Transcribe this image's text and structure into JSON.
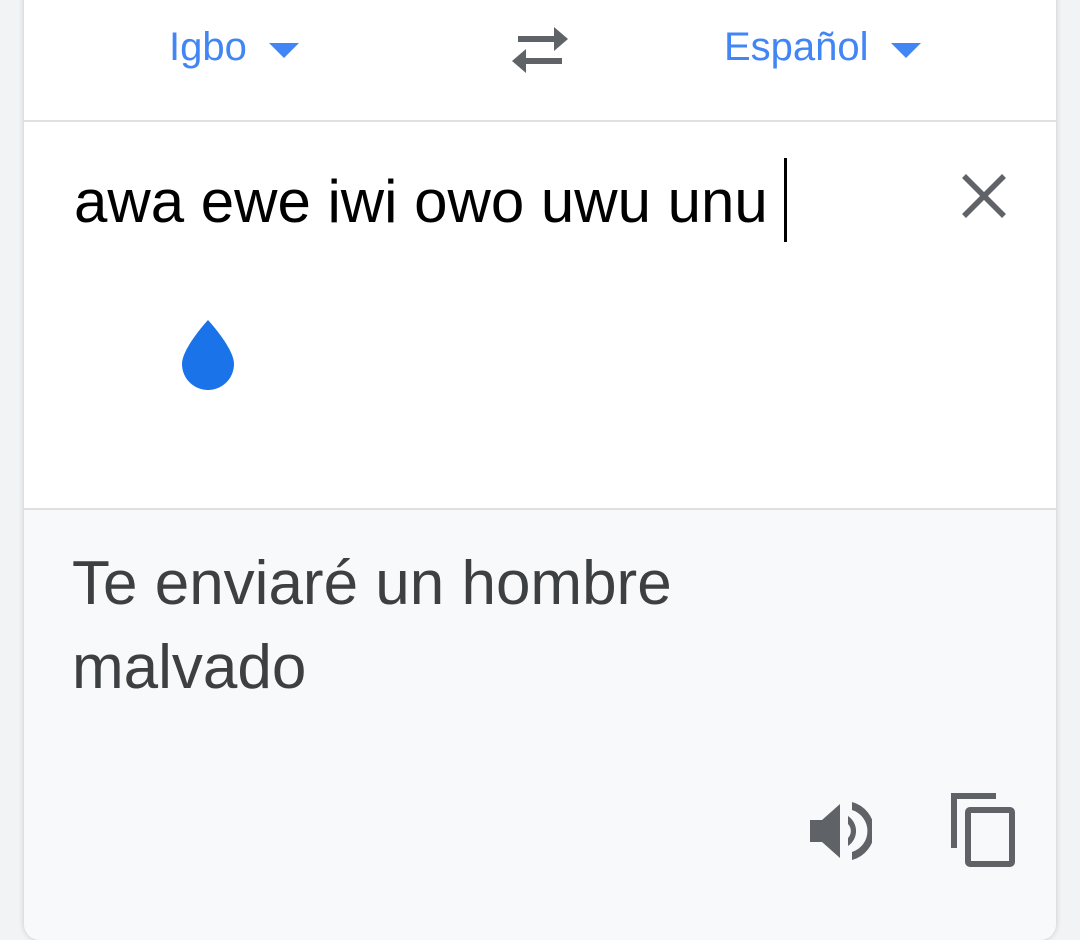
{
  "languages": {
    "source": "Igbo",
    "target": "Español"
  },
  "input": {
    "text": "awa ewe iwi owo uwu unu"
  },
  "output": {
    "text": "Te enviaré un hombre malvado"
  },
  "icons": {
    "swap": "swap-arrows-icon",
    "clear": "close-icon",
    "speaker": "speaker-icon",
    "copy": "copy-icon",
    "caret": "chevron-down-icon"
  },
  "colors": {
    "accent": "#4285f4",
    "cursor_handle": "#1a73e8",
    "input_text": "#000000",
    "output_text": "#3c4043",
    "output_bg": "#f8f9fa",
    "icon_gray": "#5f6368"
  }
}
